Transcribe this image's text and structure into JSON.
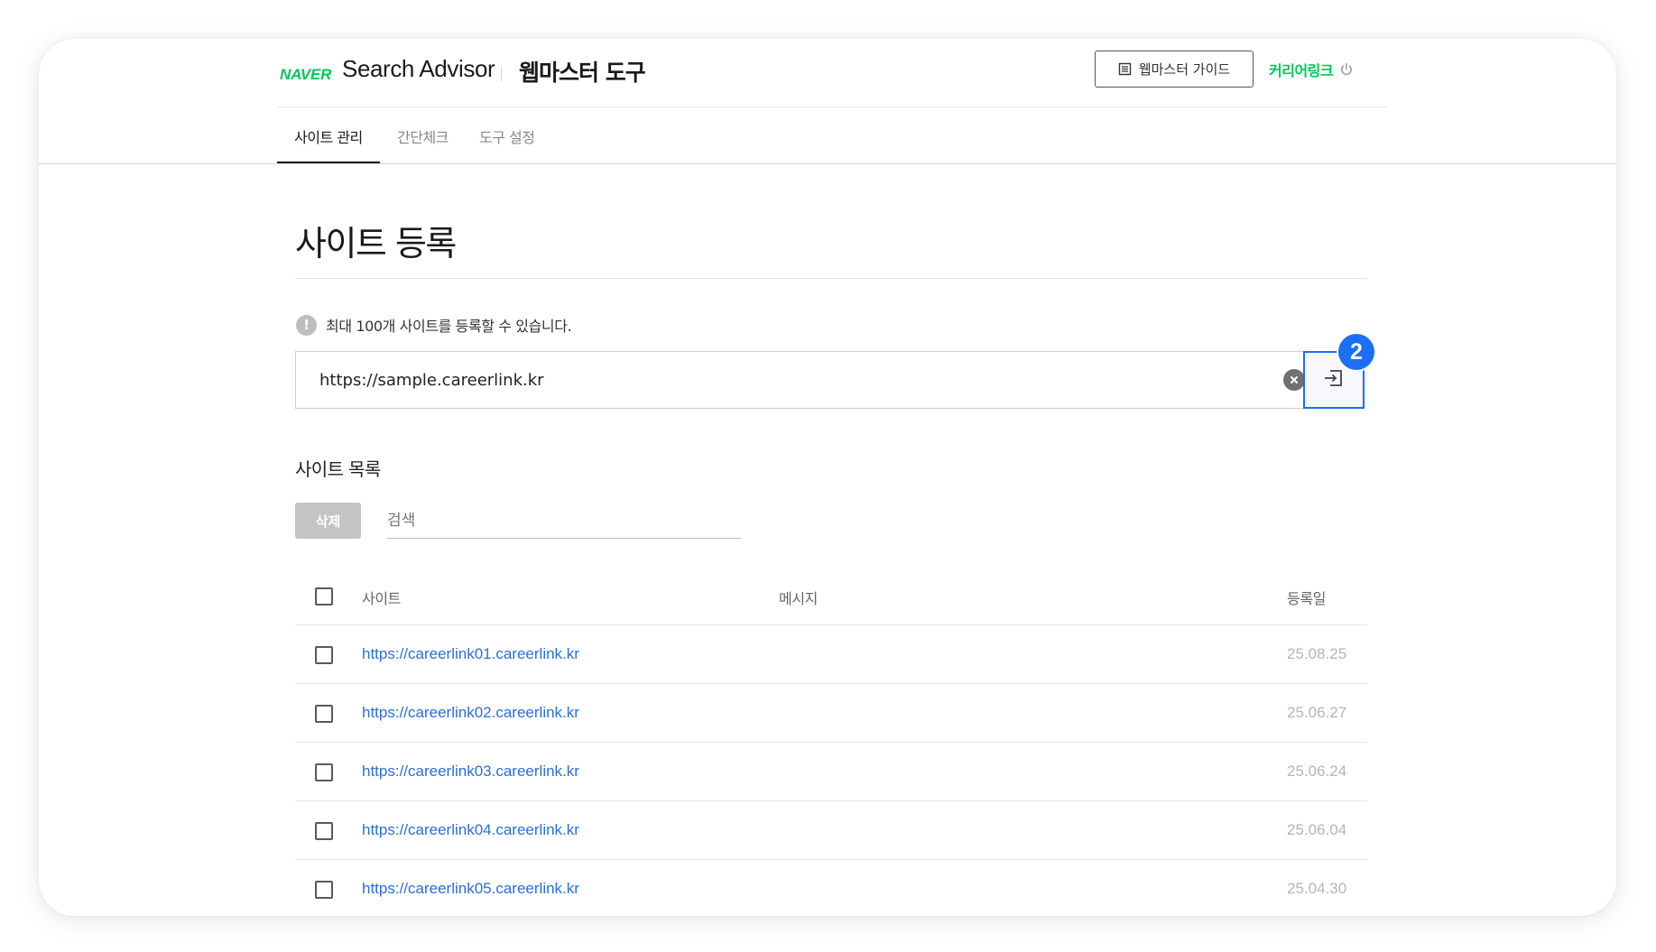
{
  "header": {
    "logo": "NAVER",
    "brand_title": "Search Advisor",
    "tool_title": "웹마스터 도구",
    "guide_button_label": "웹마스터 가이드",
    "user_name": "커리어링크"
  },
  "tabs": [
    {
      "label": "사이트 관리",
      "active": true
    },
    {
      "label": "간단체크",
      "active": false
    },
    {
      "label": "도구 설정",
      "active": false
    }
  ],
  "page": {
    "title": "사이트 등록",
    "notice": "최대 100개 사이트를 등록할 수 있습니다.",
    "url_input_value": "https://sample.careerlink.kr",
    "step_badge": "2"
  },
  "site_list": {
    "title": "사이트 목록",
    "delete_label": "삭제",
    "search_placeholder": "검색",
    "columns": {
      "site": "사이트",
      "message": "메시지",
      "date": "등록일"
    },
    "rows": [
      {
        "site": "https://careerlink01.careerlink.kr",
        "message": "",
        "date": "25.08.25"
      },
      {
        "site": "https://careerlink02.careerlink.kr",
        "message": "",
        "date": "25.06.27"
      },
      {
        "site": "https://careerlink03.careerlink.kr",
        "message": "",
        "date": "25.06.24"
      },
      {
        "site": "https://careerlink04.careerlink.kr",
        "message": "",
        "date": "25.06.04"
      },
      {
        "site": "https://careerlink05.careerlink.kr",
        "message": "",
        "date": "25.04.30"
      }
    ]
  },
  "colors": {
    "brand_green": "#03c75a",
    "accent_blue": "#1b6ff5",
    "link_blue": "#2b6fd6"
  },
  "icons": {
    "guide": "document-list-icon",
    "user": "power-icon",
    "notice": "info-icon",
    "clear": "clear-icon",
    "submit": "login-arrow-icon"
  }
}
